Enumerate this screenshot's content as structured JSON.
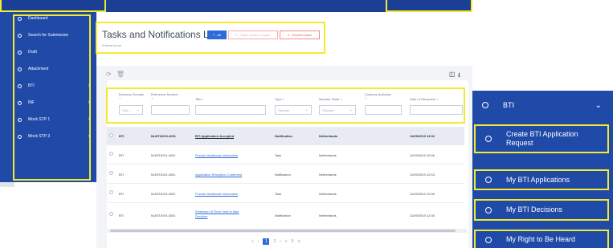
{
  "sidebar": {
    "items": [
      {
        "label": "Dashboard",
        "has_submenu": false
      },
      {
        "label": "Search for Submission",
        "has_submenu": false
      },
      {
        "label": "Draft",
        "has_submenu": false
      },
      {
        "label": "Attachment",
        "has_submenu": false
      },
      {
        "label": "BTI",
        "has_submenu": true
      },
      {
        "label": "INF",
        "has_submenu": true
      },
      {
        "label": "Mock STP 1",
        "has_submenu": true
      },
      {
        "label": "Mock STP 3",
        "has_submenu": true
      }
    ]
  },
  "page": {
    "title": "Tasks and Notifications List",
    "subtitle": "5 items found"
  },
  "filters": {
    "all": "7 - All",
    "open": "5 - Tasks about to expire",
    "expired": "0 - Expired tasks"
  },
  "toolbar": {
    "refresh_icon": "refresh-icon",
    "delete_icon": "trash-icon",
    "columns_icon": "columns-icon",
    "download_icon": "download-icon"
  },
  "table": {
    "columns": [
      {
        "label": "Business Domain ↕",
        "filter": "Cho..."
      },
      {
        "label": "Reference Number ↕",
        "filter": ""
      },
      {
        "label": "Title ↕",
        "filter": ""
      },
      {
        "label": "Type ↕",
        "filter": "Choose"
      },
      {
        "label": "Member State ↕",
        "filter": "Choose"
      },
      {
        "label": "Customs Authority ↕",
        "filter": ""
      },
      {
        "label": "Date of Reception ↕",
        "filter": ""
      }
    ],
    "rows": [
      {
        "domain": "BTI",
        "ref": "NLBTI2019-4001",
        "title": "BTI Application Accepted",
        "type": "Notification",
        "member": "Netherlands",
        "authority": "",
        "date": "11/09/2019 13:02"
      },
      {
        "domain": "BTI",
        "ref": "NLBTI2019-4001",
        "title": "Provide Additional Information",
        "type": "Task",
        "member": "Netherlands",
        "authority": "",
        "date": "11/09/2019 12:56"
      },
      {
        "domain": "BTI",
        "ref": "NLBTI2019-4001",
        "title": "Application Reception Confirmed",
        "type": "Notification",
        "member": "Netherlands",
        "authority": "",
        "date": "11/09/2019 12:53"
      },
      {
        "domain": "BTI",
        "ref": "NLBTI2019-3001",
        "title": "Provide Additional Information",
        "type": "Task",
        "member": "Netherlands",
        "authority": "",
        "date": "11/09/2019 12:36"
      },
      {
        "domain": "BTI",
        "ref": "NLBTI2019-3001",
        "title_line1": "Extension of Time Limit to take",
        "title_line2": "Decision",
        "type": "Notification",
        "member": "Netherlands",
        "authority": "",
        "date": "11/09/2019 12:36"
      }
    ]
  },
  "pager": {
    "first": "«",
    "prev": "‹",
    "current": "1",
    "next_page": "2",
    "next": "›",
    "last": "»",
    "page_size": "5",
    "page_size_caret": "∨"
  },
  "right_menu": {
    "header": "BTI",
    "items": [
      {
        "label_line1": "Create BTI Application",
        "label_line2": "Request"
      },
      {
        "label_line1": "My BTI Applications",
        "label_line2": ""
      },
      {
        "label_line1": "My BTI Decisions",
        "label_line2": ""
      },
      {
        "label_line1": "My Right to Be Heard",
        "label_line2": ""
      }
    ]
  },
  "colors": {
    "nav_blue": "#1f4aa8",
    "top_blue": "#1a3f94",
    "highlight": "#f5ea2c",
    "accent": "#2d6cd8"
  }
}
